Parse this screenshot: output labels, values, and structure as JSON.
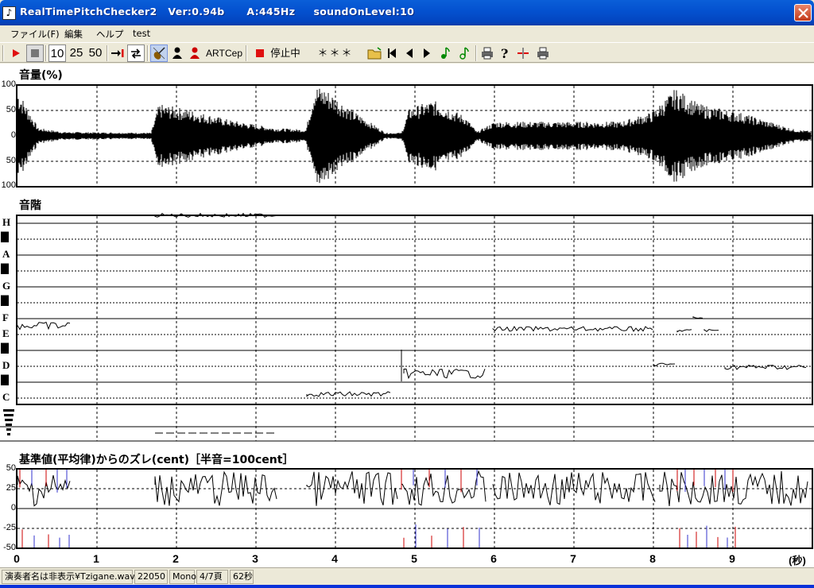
{
  "window": {
    "title": "RealTimePitchChecker2   Ver:0.94b      A:445Hz     soundOnLevel:10",
    "app_icon": "guitar-icon",
    "colors": {
      "titlebar": "#0452d0",
      "close": "#c43a1a"
    }
  },
  "menu": [
    "ファイル(F)",
    "編集",
    "ヘルプ",
    "test"
  ],
  "toolbar": {
    "zoom_buttons": [
      "10",
      "25",
      "50"
    ],
    "art_label": "ART",
    "cep_label": "Cep",
    "status_label": "停止中",
    "display": "＊＊＊",
    "icons": [
      "play-icon",
      "stop-icon",
      "jump-icon",
      "loop-icon",
      "violin-icon",
      "person-icon",
      "singer-icon",
      "record-icon",
      "folder-icon",
      "first-icon",
      "prev-icon",
      "next-icon",
      "note-icon",
      "note2-icon",
      "print-icon",
      "help-icon",
      "marker-icon",
      "print2-icon"
    ]
  },
  "volume_panel": {
    "title": "音量(%)",
    "yticks": [
      "100",
      "50",
      "0",
      "50",
      "100"
    ]
  },
  "pitch_panel": {
    "title": "音階",
    "notes": [
      "H",
      "A",
      "G",
      "F",
      "E",
      "D",
      "C"
    ]
  },
  "cent_panel": {
    "title": "基準値(平均律)からのズレ(cent)［半音=100cent］",
    "yticks": [
      "50",
      "25",
      "0",
      "-25",
      "-50"
    ]
  },
  "time_axis": {
    "ticks": [
      "0",
      "1",
      "2",
      "3",
      "4",
      "5",
      "6",
      "7",
      "8",
      "9"
    ],
    "unit": "(秒)"
  },
  "status": {
    "file": "演奏者名は非表示¥Tzigane.wav",
    "rate": "22050",
    "channels": "Mono",
    "page": "4/7頁",
    "duration": "62秒"
  }
}
